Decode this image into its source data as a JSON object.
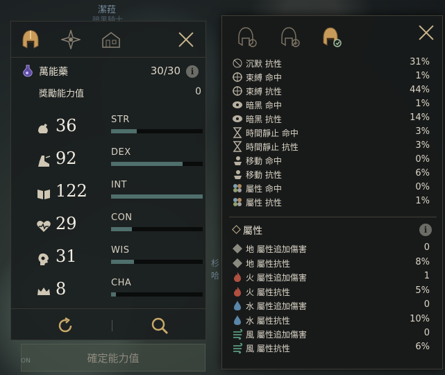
{
  "map": {
    "label_top": "潔菈",
    "label_top2": "暗黑騎士",
    "frag1": "杉",
    "frag2": "哈"
  },
  "left_panel": {
    "tabs": [
      "helmet-tab",
      "compass-tab",
      "building-tab"
    ],
    "elixir": {
      "name": "萬能藥",
      "count": "30/30"
    },
    "bonus": {
      "label": "獎勵能力值",
      "value": "0"
    },
    "stats": [
      {
        "value": "36",
        "name": "STR",
        "fill": 0.28
      },
      {
        "value": "92",
        "name": "DEX",
        "fill": 0.78
      },
      {
        "value": "122",
        "name": "INT",
        "fill": 1.0
      },
      {
        "value": "29",
        "name": "CON",
        "fill": 0.23
      },
      {
        "value": "31",
        "name": "WIS",
        "fill": 0.25
      },
      {
        "value": "8",
        "name": "CHA",
        "fill": 0.05
      }
    ],
    "confirm_label": "確定能力值",
    "on_badge": "ON"
  },
  "right_panel": {
    "resist_rows": [
      {
        "label": "沉默 抗性",
        "value": "31%",
        "icon": "silence-icon"
      },
      {
        "label": "束縛 命中",
        "value": "1%",
        "icon": "bind-icon"
      },
      {
        "label": "束縛 抗性",
        "value": "44%",
        "icon": "bind-icon"
      },
      {
        "label": "暗黑 命中",
        "value": "1%",
        "icon": "dark-icon"
      },
      {
        "label": "暗黑 抗性",
        "value": "14%",
        "icon": "dark-icon"
      },
      {
        "label": "時間靜止 命中",
        "value": "3%",
        "icon": "hourglass-icon"
      },
      {
        "label": "時間靜止 抗性",
        "value": "3%",
        "icon": "hourglass-icon"
      },
      {
        "label": "移動 命中",
        "value": "0%",
        "icon": "move-icon"
      },
      {
        "label": "移動 抗性",
        "value": "6%",
        "icon": "move-icon"
      },
      {
        "label": "屬性 命中",
        "value": "0%",
        "icon": "element-icon"
      },
      {
        "label": "屬性 抗性",
        "value": "1%",
        "icon": "element-icon"
      }
    ],
    "attr_title": "屬性",
    "element_rows": [
      {
        "label": "地 屬性追加傷害",
        "value": "0",
        "color": "#8a8a80"
      },
      {
        "label": "地 屬性抗性",
        "value": "8%",
        "color": "#8a8a80"
      },
      {
        "label": "火 屬性追加傷害",
        "value": "1",
        "color": "#b05040"
      },
      {
        "label": "火 屬性抗性",
        "value": "5%",
        "color": "#b05040"
      },
      {
        "label": "水 屬性追加傷害",
        "value": "0",
        "color": "#5a86a8"
      },
      {
        "label": "水 屬性抗性",
        "value": "10%",
        "color": "#5a86a8"
      },
      {
        "label": "風 屬性追加傷害",
        "value": "0",
        "color": "#5a9a80"
      },
      {
        "label": "風 屬性抗性",
        "value": "6%",
        "color": "#5a9a80"
      }
    ]
  }
}
